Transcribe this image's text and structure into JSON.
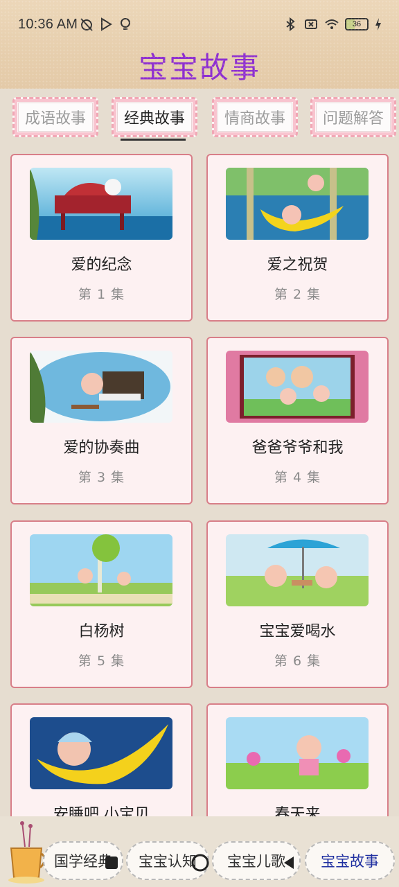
{
  "status_bar": {
    "time": "10:36 AM",
    "battery": "36"
  },
  "app": {
    "title": "宝宝故事"
  },
  "tabs": [
    {
      "label": "成语故事",
      "active": false
    },
    {
      "label": "经典故事",
      "active": true
    },
    {
      "label": "情商故事",
      "active": false
    },
    {
      "label": "问题解答",
      "active": false
    }
  ],
  "stories": [
    {
      "title": "爱的纪念",
      "episode": "第 1 集"
    },
    {
      "title": "爱之祝贺",
      "episode": "第 2 集"
    },
    {
      "title": "爱的协奏曲",
      "episode": "第 3 集"
    },
    {
      "title": "爸爸爷爷和我",
      "episode": "第 4 集"
    },
    {
      "title": "白杨树",
      "episode": "第 5 集"
    },
    {
      "title": "宝宝爱喝水",
      "episode": "第 6 集"
    },
    {
      "title": "安睡吧 小宝贝",
      "episode": ""
    },
    {
      "title": "春天来",
      "episode": ""
    }
  ],
  "bottom_nav": [
    {
      "label": "国学经典",
      "active": false
    },
    {
      "label": "宝宝认知",
      "active": false
    },
    {
      "label": "宝宝儿歌",
      "active": false
    },
    {
      "label": "宝宝故事",
      "active": true
    }
  ],
  "colors": {
    "title_purple": "#8e2fcf",
    "card_border": "#d87e88",
    "card_bg": "#fdf1f2",
    "active_nav_blue": "#1f2fa0"
  }
}
